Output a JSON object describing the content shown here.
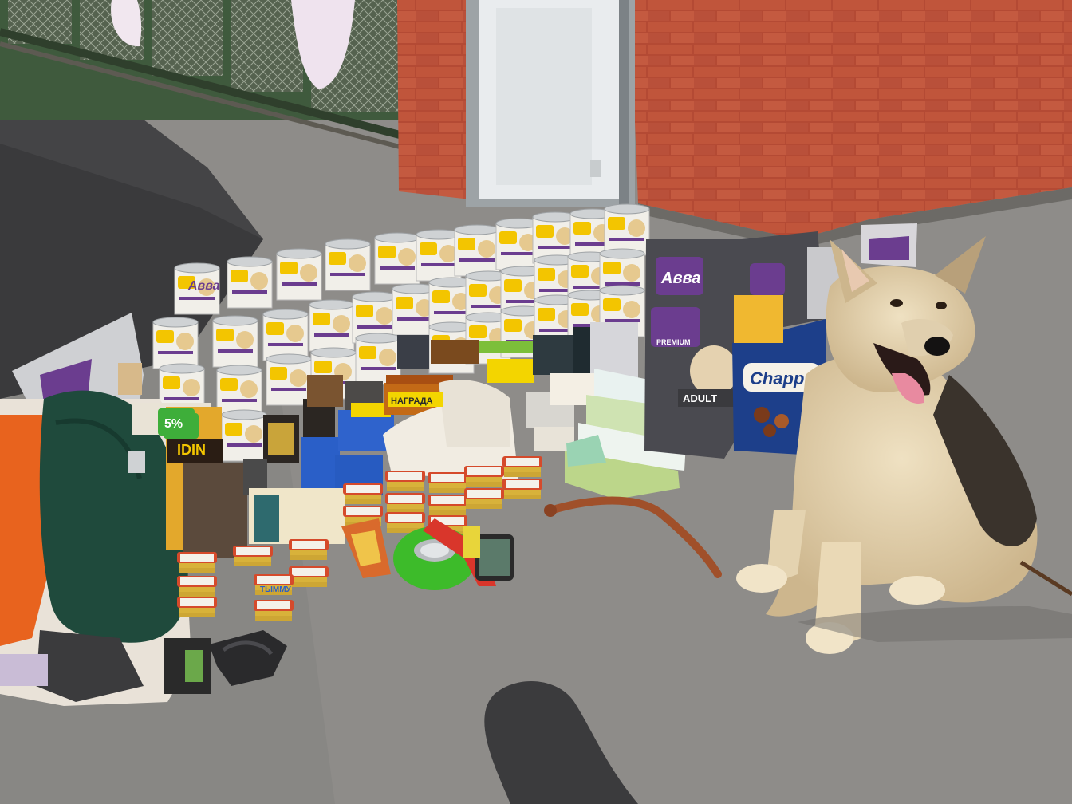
{
  "photo": {
    "subject": "dog",
    "colors": {
      "pavement": "#8e8c89",
      "shadow": "#3a3a3c",
      "brick": "#b44a34",
      "fence_green": "#3f5a3d",
      "door": "#e9ecee",
      "can_lid": "#cfd2d4",
      "can_label": "#f1efe9",
      "brand_purple": "#6b3d8f",
      "bag_gray": "#4a4a50",
      "chappi_blue": "#1d3f8a",
      "bowl_green": "#3dbb2a",
      "dog_fur": "#d9c7a3",
      "dog_dark": "#3a332c",
      "collar": "#a0502a",
      "jacket_green": "#1f4a3c",
      "jacket_orange": "#e8631e"
    },
    "visible_text": {
      "can_brand": "Авва",
      "bag_brand": "Авва",
      "bag_sublabel": "PREMIUM",
      "bag_adult": "ADULT",
      "chappi_brand": "Chapp",
      "tray_brand": "ТЫММУ",
      "box_partial": "IDIN",
      "sticker_partial": "5%",
      "sticker_text": "НАГРАДА"
    }
  }
}
